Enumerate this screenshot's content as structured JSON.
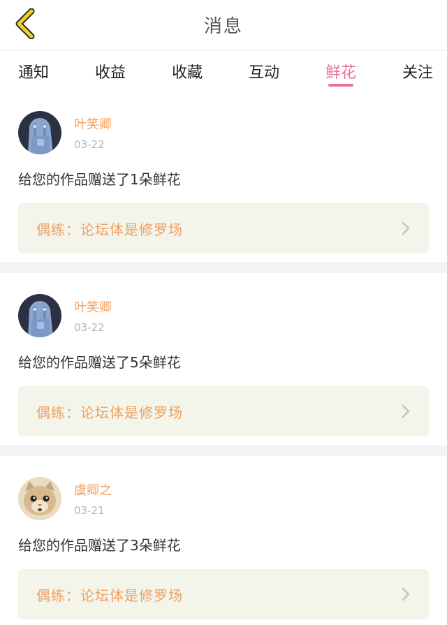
{
  "header": {
    "title": "消息",
    "back_icon": "chevron-left-icon",
    "accent": "#f5d020"
  },
  "tabs": [
    {
      "label": "通知",
      "active": false
    },
    {
      "label": "收益",
      "active": false
    },
    {
      "label": "收藏",
      "active": false
    },
    {
      "label": "互动",
      "active": false
    },
    {
      "label": "鲜花",
      "active": true
    },
    {
      "label": "关注",
      "active": false
    }
  ],
  "colors": {
    "active_tab": "#e8729f",
    "username": "#f0a060",
    "link_background": "#f3f4ea"
  },
  "notifications": [
    {
      "avatar": "avatar-denim-overalls",
      "username": "叶笑卿",
      "date": "03-22",
      "message": "给您的作品赠送了1朵鲜花",
      "work_title": "偶练：论坛体是修罗场"
    },
    {
      "avatar": "avatar-denim-overalls",
      "username": "叶笑卿",
      "date": "03-22",
      "message": "给您的作品赠送了5朵鲜花",
      "work_title": "偶练：论坛体是修罗场"
    },
    {
      "avatar": "avatar-cat",
      "username": "虞卿之",
      "date": "03-21",
      "message": "给您的作品赠送了3朵鲜花",
      "work_title": "偶练：论坛体是修罗场"
    }
  ]
}
